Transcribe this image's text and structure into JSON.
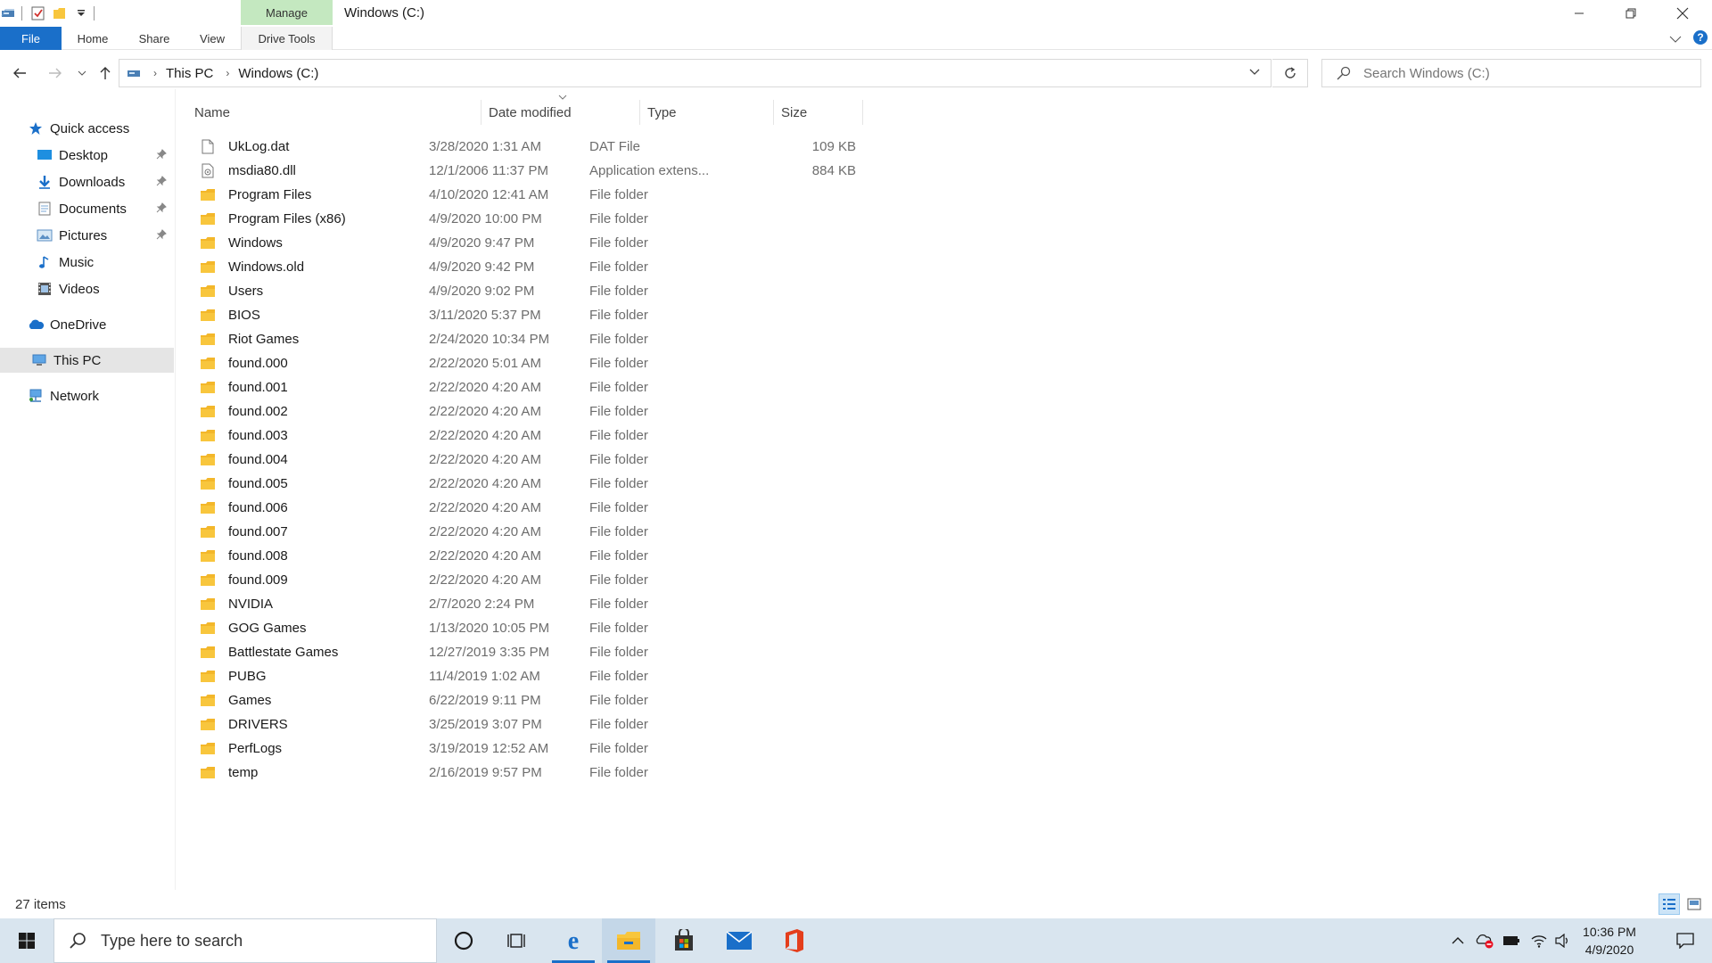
{
  "titlebar": {
    "manage_label": "Manage",
    "window_title": "Windows (C:)"
  },
  "ribbon": {
    "tabs": [
      "File",
      "Home",
      "Share",
      "View",
      "Drive Tools"
    ]
  },
  "address": {
    "crumbs": [
      "This PC",
      "Windows (C:)"
    ],
    "search_placeholder": "Search Windows (C:)"
  },
  "navpane": {
    "quick_access": "Quick access",
    "pinned": [
      "Desktop",
      "Downloads",
      "Documents",
      "Pictures"
    ],
    "unpinned": [
      "Music",
      "Videos"
    ],
    "onedrive": "OneDrive",
    "this_pc": "This PC",
    "network": "Network"
  },
  "columns": {
    "name": "Name",
    "date": "Date modified",
    "type": "Type",
    "size": "Size"
  },
  "files": [
    {
      "name": "UkLog.dat",
      "date": "3/28/2020 1:31 AM",
      "type": "DAT File",
      "size": "109 KB",
      "icon": "file-icon"
    },
    {
      "name": "msdia80.dll",
      "date": "12/1/2006 11:37 PM",
      "type": "Application extens...",
      "size": "884 KB",
      "icon": "dll-icon"
    },
    {
      "name": "Program Files",
      "date": "4/10/2020 12:41 AM",
      "type": "File folder",
      "size": "",
      "icon": "folder-icon"
    },
    {
      "name": "Program Files (x86)",
      "date": "4/9/2020 10:00 PM",
      "type": "File folder",
      "size": "",
      "icon": "folder-icon"
    },
    {
      "name": "Windows",
      "date": "4/9/2020 9:47 PM",
      "type": "File folder",
      "size": "",
      "icon": "folder-icon"
    },
    {
      "name": "Windows.old",
      "date": "4/9/2020 9:42 PM",
      "type": "File folder",
      "size": "",
      "icon": "folder-icon"
    },
    {
      "name": "Users",
      "date": "4/9/2020 9:02 PM",
      "type": "File folder",
      "size": "",
      "icon": "folder-icon"
    },
    {
      "name": "BIOS",
      "date": "3/11/2020 5:37 PM",
      "type": "File folder",
      "size": "",
      "icon": "folder-icon"
    },
    {
      "name": "Riot Games",
      "date": "2/24/2020 10:34 PM",
      "type": "File folder",
      "size": "",
      "icon": "folder-icon"
    },
    {
      "name": "found.000",
      "date": "2/22/2020 5:01 AM",
      "type": "File folder",
      "size": "",
      "icon": "folder-icon"
    },
    {
      "name": "found.001",
      "date": "2/22/2020 4:20 AM",
      "type": "File folder",
      "size": "",
      "icon": "folder-icon"
    },
    {
      "name": "found.002",
      "date": "2/22/2020 4:20 AM",
      "type": "File folder",
      "size": "",
      "icon": "folder-icon"
    },
    {
      "name": "found.003",
      "date": "2/22/2020 4:20 AM",
      "type": "File folder",
      "size": "",
      "icon": "folder-icon"
    },
    {
      "name": "found.004",
      "date": "2/22/2020 4:20 AM",
      "type": "File folder",
      "size": "",
      "icon": "folder-icon"
    },
    {
      "name": "found.005",
      "date": "2/22/2020 4:20 AM",
      "type": "File folder",
      "size": "",
      "icon": "folder-icon"
    },
    {
      "name": "found.006",
      "date": "2/22/2020 4:20 AM",
      "type": "File folder",
      "size": "",
      "icon": "folder-icon"
    },
    {
      "name": "found.007",
      "date": "2/22/2020 4:20 AM",
      "type": "File folder",
      "size": "",
      "icon": "folder-icon"
    },
    {
      "name": "found.008",
      "date": "2/22/2020 4:20 AM",
      "type": "File folder",
      "size": "",
      "icon": "folder-icon"
    },
    {
      "name": "found.009",
      "date": "2/22/2020 4:20 AM",
      "type": "File folder",
      "size": "",
      "icon": "folder-icon"
    },
    {
      "name": "NVIDIA",
      "date": "2/7/2020 2:24 PM",
      "type": "File folder",
      "size": "",
      "icon": "folder-icon"
    },
    {
      "name": "GOG Games",
      "date": "1/13/2020 10:05 PM",
      "type": "File folder",
      "size": "",
      "icon": "folder-icon"
    },
    {
      "name": "Battlestate Games",
      "date": "12/27/2019 3:35 PM",
      "type": "File folder",
      "size": "",
      "icon": "folder-icon"
    },
    {
      "name": "PUBG",
      "date": "11/4/2019 1:02 AM",
      "type": "File folder",
      "size": "",
      "icon": "folder-icon"
    },
    {
      "name": "Games",
      "date": "6/22/2019 9:11 PM",
      "type": "File folder",
      "size": "",
      "icon": "folder-icon"
    },
    {
      "name": "DRIVERS",
      "date": "3/25/2019 3:07 PM",
      "type": "File folder",
      "size": "",
      "icon": "folder-icon"
    },
    {
      "name": "PerfLogs",
      "date": "3/19/2019 12:52 AM",
      "type": "File folder",
      "size": "",
      "icon": "folder-icon"
    },
    {
      "name": "temp",
      "date": "2/16/2019 9:57 PM",
      "type": "File folder",
      "size": "",
      "icon": "folder-icon"
    }
  ],
  "statusbar": {
    "item_count": "27 items"
  },
  "taskbar": {
    "search_placeholder": "Type here to search",
    "time": "10:36 PM",
    "date": "4/9/2020"
  },
  "colors": {
    "accent": "#1a6fc9",
    "manage_tab": "#c4e8c0",
    "folder": "#f8c63d",
    "taskbar": "#d9e5ef"
  }
}
